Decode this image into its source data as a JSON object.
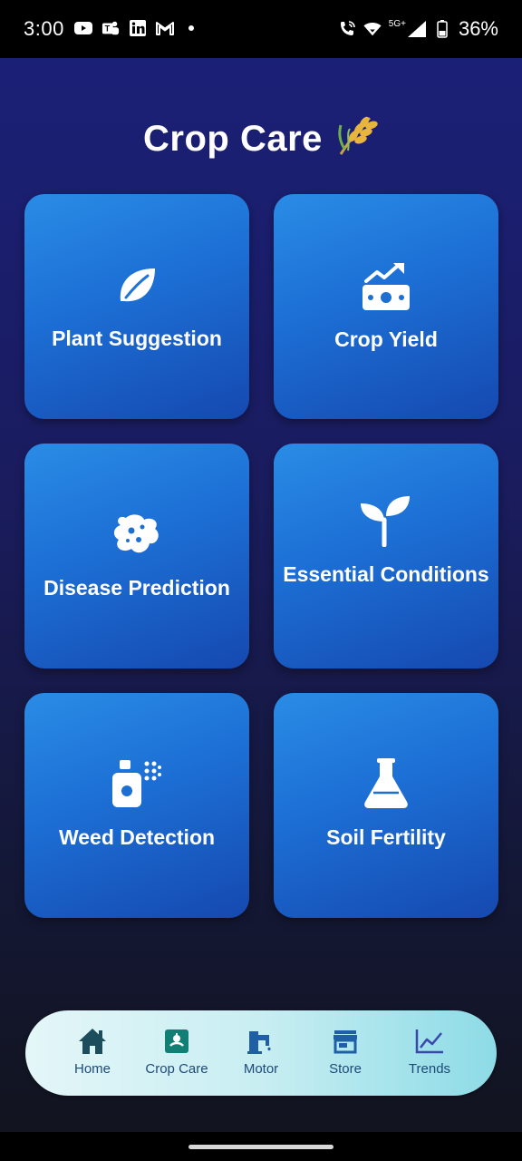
{
  "status_bar": {
    "time": "3:00",
    "network": "5G+",
    "battery": "36%",
    "left_icons": [
      "youtube-icon",
      "teams-icon",
      "linkedin-icon",
      "gmail-icon"
    ],
    "right_icons": [
      "wifi-calling-icon",
      "wifi-icon",
      "signal-icon",
      "battery-icon"
    ]
  },
  "app": {
    "title": "Crop Care",
    "title_icon": "wheat-icon",
    "cards": [
      {
        "label": "Plant Suggestion",
        "icon": "leaf-icon"
      },
      {
        "label": "Crop Yield",
        "icon": "money-growth-icon"
      },
      {
        "label": "Disease Prediction",
        "icon": "bacteria-icon"
      },
      {
        "label": "Essential Conditions",
        "icon": "seedling-icon"
      },
      {
        "label": "Weed Detection",
        "icon": "spray-bottle-icon"
      },
      {
        "label": "Soil Fertility",
        "icon": "flask-icon"
      }
    ]
  },
  "bottom_nav": {
    "items": [
      {
        "label": "Home",
        "icon": "home-icon"
      },
      {
        "label": "Crop Care",
        "icon": "crop-care-icon"
      },
      {
        "label": "Motor",
        "icon": "motor-icon"
      },
      {
        "label": "Store",
        "icon": "store-icon"
      },
      {
        "label": "Trends",
        "icon": "trends-icon"
      }
    ]
  },
  "colors": {
    "card_gradient_start": "#2a8ce6",
    "card_gradient_end": "#1549b0",
    "background_top": "#1b2077",
    "background_bottom": "#12141f",
    "nav_text": "#1d4a78"
  }
}
